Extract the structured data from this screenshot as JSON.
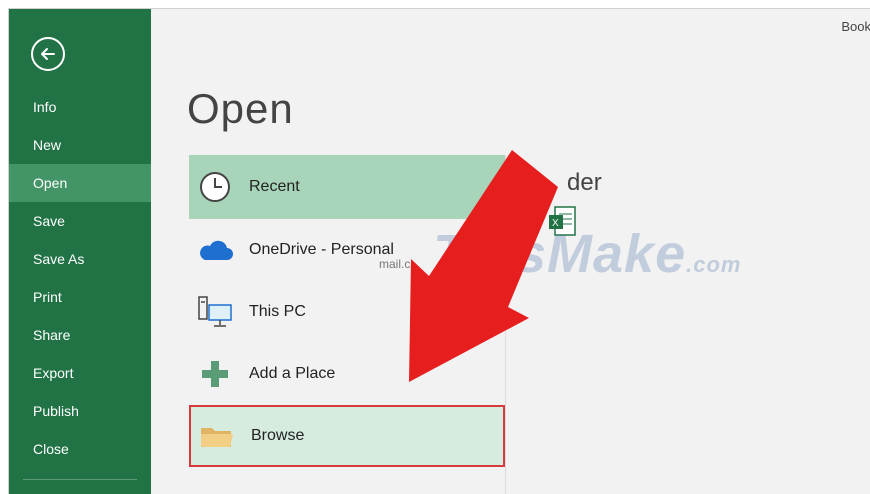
{
  "window": {
    "book_label": "Book"
  },
  "sidebar": {
    "items": [
      {
        "label": "Info"
      },
      {
        "label": "New"
      },
      {
        "label": "Open"
      },
      {
        "label": "Save"
      },
      {
        "label": "Save As"
      },
      {
        "label": "Print"
      },
      {
        "label": "Share"
      },
      {
        "label": "Export"
      },
      {
        "label": "Publish"
      },
      {
        "label": "Close"
      }
    ],
    "active": "Open",
    "background": "#217346",
    "active_background": "#439467"
  },
  "main": {
    "title": "Open",
    "locations": [
      {
        "label": "Recent",
        "icon": "clock-icon",
        "selected": true
      },
      {
        "label": "OneDrive - Personal",
        "icon": "cloud-icon",
        "sublabel": "mail.c"
      },
      {
        "label": "This PC",
        "icon": "computer-icon"
      },
      {
        "label": "Add a Place",
        "icon": "plus-icon"
      },
      {
        "label": "Browse",
        "icon": "folder-icon",
        "highlighted": true
      }
    ],
    "right_panel_title": "der"
  },
  "watermark": {
    "text": "TipsMake",
    "suffix": ".com"
  },
  "annotation": {
    "arrow_color": "#e61e1e",
    "highlight_border": "#d63a3a"
  }
}
